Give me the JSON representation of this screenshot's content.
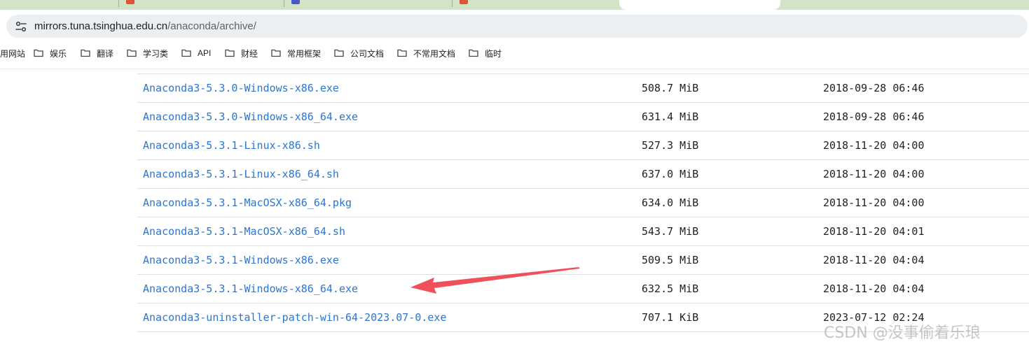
{
  "browser": {
    "address_bar": {
      "host": "mirrors.tuna.tsinghua.edu.cn",
      "path": "/anaconda/archive/"
    },
    "bookmarks": [
      {
        "label": "用网站",
        "icon": "none"
      },
      {
        "label": "娱乐",
        "icon": "folder-icon"
      },
      {
        "label": "翻译",
        "icon": "folder-icon"
      },
      {
        "label": "学习类",
        "icon": "folder-icon"
      },
      {
        "label": "API",
        "icon": "folder-icon"
      },
      {
        "label": "财经",
        "icon": "folder-icon"
      },
      {
        "label": "常用框架",
        "icon": "folder-icon"
      },
      {
        "label": "公司文档",
        "icon": "folder-icon"
      },
      {
        "label": "不常用文档",
        "icon": "folder-icon"
      },
      {
        "label": "临时",
        "icon": "folder-icon"
      }
    ]
  },
  "files": [
    {
      "name": "Anaconda3-5.3.0-Windows-x86.exe",
      "size": "508.7 MiB",
      "date": "2018-09-28 06:46"
    },
    {
      "name": "Anaconda3-5.3.0-Windows-x86_64.exe",
      "size": "631.4 MiB",
      "date": "2018-09-28 06:46"
    },
    {
      "name": "Anaconda3-5.3.1-Linux-x86.sh",
      "size": "527.3 MiB",
      "date": "2018-11-20 04:00"
    },
    {
      "name": "Anaconda3-5.3.1-Linux-x86_64.sh",
      "size": "637.0 MiB",
      "date": "2018-11-20 04:00"
    },
    {
      "name": "Anaconda3-5.3.1-MacOSX-x86_64.pkg",
      "size": "634.0 MiB",
      "date": "2018-11-20 04:00"
    },
    {
      "name": "Anaconda3-5.3.1-MacOSX-x86_64.sh",
      "size": "543.7 MiB",
      "date": "2018-11-20 04:01"
    },
    {
      "name": "Anaconda3-5.3.1-Windows-x86.exe",
      "size": "509.5 MiB",
      "date": "2018-11-20 04:04"
    },
    {
      "name": "Anaconda3-5.3.1-Windows-x86_64.exe",
      "size": "632.5 MiB",
      "date": "2018-11-20 04:04"
    },
    {
      "name": "Anaconda3-uninstaller-patch-win-64-2023.07-0.exe",
      "size": "707.1 KiB",
      "date": "2023-07-12 02:24"
    }
  ],
  "annotation": {
    "arrow_color": "#f0505a",
    "points_to": "Anaconda3-5.3.1-Windows-x86_64.exe"
  },
  "watermark": "CSDN @没事偷着乐琅",
  "colors": {
    "link": "#2a76d2",
    "tabstrip": "#d3e3c6",
    "omnibox": "#eceff1"
  }
}
